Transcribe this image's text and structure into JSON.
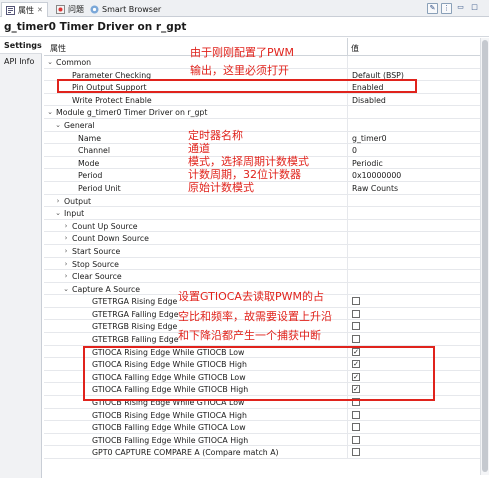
{
  "tabs": {
    "properties": "属性",
    "problems": "问题",
    "smart_browser": "Smart Browser"
  },
  "title": "g_timer0 Timer Driver on r_gpt",
  "side_tabs": [
    "Settings",
    "API Info"
  ],
  "columns": {
    "property": "属性",
    "value": "值"
  },
  "rows": [
    {
      "label": "Common",
      "indent": 0,
      "toggle": "v",
      "value": ""
    },
    {
      "label": "Parameter Checking",
      "indent": 2,
      "toggle": "",
      "value": "Default (BSP)"
    },
    {
      "label": "Pin Output Support",
      "indent": 2,
      "toggle": "",
      "value": "Enabled"
    },
    {
      "label": "Write Protect Enable",
      "indent": 2,
      "toggle": "",
      "value": "Disabled"
    },
    {
      "label": "Module g_timer0 Timer Driver on r_gpt",
      "indent": 0,
      "toggle": "v",
      "value": ""
    },
    {
      "label": "General",
      "indent": 1,
      "toggle": "v",
      "value": ""
    },
    {
      "label": "Name",
      "indent": 3,
      "toggle": "",
      "value": "g_timer0"
    },
    {
      "label": "Channel",
      "indent": 3,
      "toggle": "",
      "value": "0"
    },
    {
      "label": "Mode",
      "indent": 3,
      "toggle": "",
      "value": "Periodic"
    },
    {
      "label": "Period",
      "indent": 3,
      "toggle": "",
      "value": "0x10000000"
    },
    {
      "label": "Period Unit",
      "indent": 3,
      "toggle": "",
      "value": "Raw Counts"
    },
    {
      "label": "Output",
      "indent": 1,
      "toggle": ">",
      "value": ""
    },
    {
      "label": "Input",
      "indent": 1,
      "toggle": "v",
      "value": ""
    },
    {
      "label": "Count Up Source",
      "indent": 2,
      "toggle": ">",
      "value": ""
    },
    {
      "label": "Count Down Source",
      "indent": 2,
      "toggle": ">",
      "value": ""
    },
    {
      "label": "Start Source",
      "indent": 2,
      "toggle": ">",
      "value": ""
    },
    {
      "label": "Stop Source",
      "indent": 2,
      "toggle": ">",
      "value": ""
    },
    {
      "label": "Clear Source",
      "indent": 2,
      "toggle": ">",
      "value": ""
    },
    {
      "label": "Capture A Source",
      "indent": 2,
      "toggle": "v",
      "value": ""
    },
    {
      "label": "GTETRGA Rising Edge",
      "indent": 4,
      "toggle": "",
      "check": false
    },
    {
      "label": "GTETRGA Falling Edge",
      "indent": 4,
      "toggle": "",
      "check": false
    },
    {
      "label": "GTETRGB Rising Edge",
      "indent": 4,
      "toggle": "",
      "check": false
    },
    {
      "label": "GTETRGB Falling Edge",
      "indent": 4,
      "toggle": "",
      "check": false
    },
    {
      "label": "GTIOCA Rising Edge While GTIOCB Low",
      "indent": 4,
      "toggle": "",
      "check": true
    },
    {
      "label": "GTIOCA Rising Edge While GTIOCB High",
      "indent": 4,
      "toggle": "",
      "check": true
    },
    {
      "label": "GTIOCA Falling Edge While GTIOCB Low",
      "indent": 4,
      "toggle": "",
      "check": true
    },
    {
      "label": "GTIOCA Falling Edge While GTIOCB High",
      "indent": 4,
      "toggle": "",
      "check": true
    },
    {
      "label": "GTIOCB Rising Edge While GTIOCA Low",
      "indent": 4,
      "toggle": "",
      "check": false
    },
    {
      "label": "GTIOCB Rising Edge While GTIOCA High",
      "indent": 4,
      "toggle": "",
      "check": false
    },
    {
      "label": "GTIOCB Falling Edge While GTIOCA Low",
      "indent": 4,
      "toggle": "",
      "check": false
    },
    {
      "label": "GTIOCB Falling Edge While GTIOCA High",
      "indent": 4,
      "toggle": "",
      "check": false
    },
    {
      "label": "GPT0 CAPTURE COMPARE A (Compare match A)",
      "indent": 4,
      "toggle": "",
      "check": false
    }
  ],
  "annotations": {
    "pwm_line1": "由于刚刚配置了PWM",
    "pwm_line2": "输出，这里必须打开",
    "name": "定时器名称",
    "channel": "通道",
    "mode": "模式，选择周期计数模式",
    "period": "计数周期，32位计数器",
    "unit": "原始计数模式",
    "cap_line1": "设置GTIOCA去读取PWM的占",
    "cap_line2": "空比和频率，故需要设置上升沿",
    "cap_line3": "和下降沿都产生一个捕获中断"
  },
  "colors": {
    "annotation": "#e0231c"
  }
}
